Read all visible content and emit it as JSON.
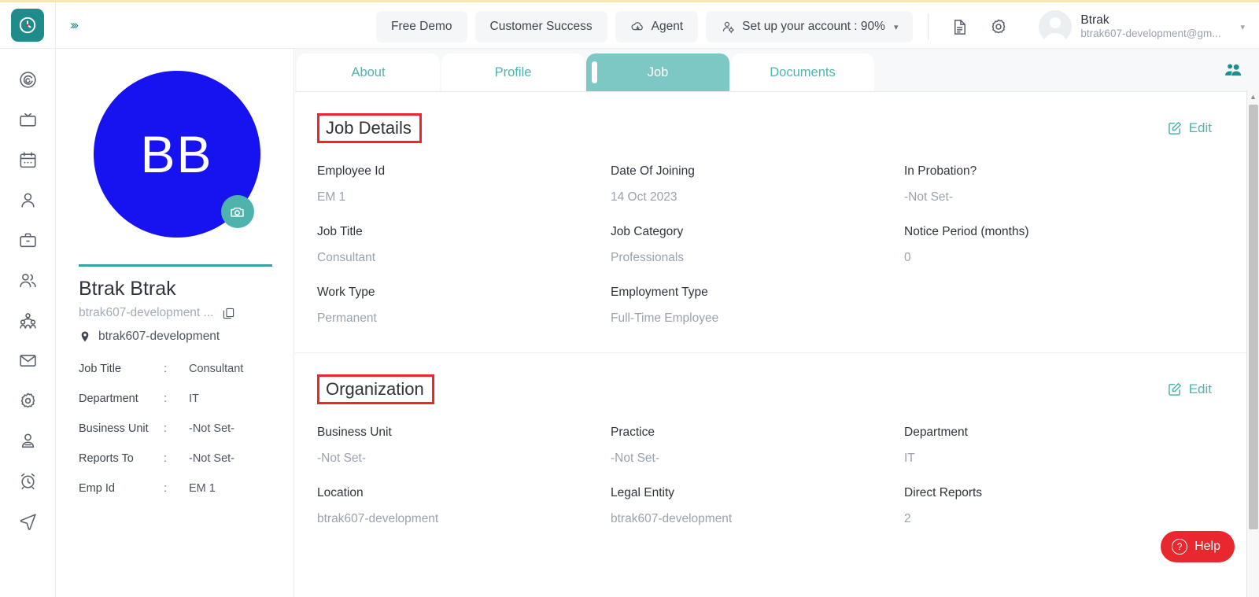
{
  "topbar": {
    "logo_icon": "clock-logo-icon",
    "expand_icon": "chevron-double-right-icon",
    "expand_label": "›››",
    "actions": [
      {
        "label": "Free Demo",
        "icon": ""
      },
      {
        "label": "Customer Success",
        "icon": ""
      },
      {
        "label": "Agent",
        "icon": "cloud-download-icon"
      },
      {
        "label": "Set up your account : 90%",
        "icon": "user-settings-icon",
        "caret": "▾"
      }
    ],
    "doc_icon": "document-icon",
    "gear_icon": "gear-icon",
    "user": {
      "avatar_icon": "avatar-placeholder-icon",
      "name": "Btrak",
      "email": "btrak607-development@gm...",
      "caret": "▾"
    }
  },
  "sidebar": {
    "items": [
      {
        "icon": "dashboard-spiral-icon",
        "name": "dashboard"
      },
      {
        "icon": "tv-monitor-icon",
        "name": "broadcast"
      },
      {
        "icon": "calendar-icon",
        "name": "calendar"
      },
      {
        "icon": "person-icon",
        "name": "employee"
      },
      {
        "icon": "briefcase-icon",
        "name": "jobs"
      },
      {
        "icon": "people-icon",
        "name": "teams"
      },
      {
        "icon": "org-chart-icon",
        "name": "organization"
      },
      {
        "icon": "mail-icon",
        "name": "inbox"
      },
      {
        "icon": "gear-icon",
        "name": "settings"
      },
      {
        "icon": "user-badge-icon",
        "name": "profile"
      },
      {
        "icon": "alarm-clock-icon",
        "name": "timesheet"
      },
      {
        "icon": "send-navigate-icon",
        "name": "send"
      }
    ]
  },
  "profile": {
    "avatar_initials": "BB",
    "avatar_color": "#1712f0",
    "camera_icon": "camera-icon",
    "name": "Btrak Btrak",
    "email": "btrak607-development ...",
    "copy_icon": "copy-icon",
    "location_icon": "map-pin-icon",
    "location": "btrak607-development",
    "separator": ":",
    "details": [
      {
        "key": "Job Title",
        "value": "Consultant"
      },
      {
        "key": "Department",
        "value": "IT"
      },
      {
        "key": "Business Unit",
        "value": "-Not Set-"
      },
      {
        "key": "Reports To",
        "value": "-Not Set-"
      },
      {
        "key": "Emp Id",
        "value": "EM 1"
      }
    ]
  },
  "main": {
    "tabs": [
      {
        "label": "About",
        "active": false
      },
      {
        "label": "Profile",
        "active": false
      },
      {
        "label": "Job",
        "active": true
      },
      {
        "label": "Documents",
        "active": false
      }
    ],
    "people_icon": "people-icon",
    "sections": [
      {
        "title": "Job Details",
        "edit_label": "Edit",
        "edit_icon": "edit-pencil-icon",
        "fields": [
          {
            "label": "Employee Id",
            "value": "EM 1"
          },
          {
            "label": "Date Of Joining",
            "value": "14 Oct 2023"
          },
          {
            "label": "In Probation?",
            "value": "-Not Set-"
          },
          {
            "label": "Job Title",
            "value": "Consultant"
          },
          {
            "label": "Job Category",
            "value": "Professionals"
          },
          {
            "label": "Notice Period (months)",
            "value": "0"
          },
          {
            "label": "Work Type",
            "value": "Permanent"
          },
          {
            "label": "Employment Type",
            "value": "Full-Time Employee"
          },
          {
            "label": "",
            "value": ""
          }
        ]
      },
      {
        "title": "Organization",
        "edit_label": "Edit",
        "edit_icon": "edit-pencil-icon",
        "fields": [
          {
            "label": "Business Unit",
            "value": "-Not Set-"
          },
          {
            "label": "Practice",
            "value": "-Not Set-"
          },
          {
            "label": "Department",
            "value": "IT"
          },
          {
            "label": "Location",
            "value": "btrak607-development"
          },
          {
            "label": "Legal Entity",
            "value": "btrak607-development"
          },
          {
            "label": "Direct Reports",
            "value": "2"
          }
        ]
      }
    ]
  },
  "scrollbar": {
    "up_arrow": "▲"
  },
  "help": {
    "label": "Help",
    "icon": "question-mark-icon",
    "glyph": "?",
    "color": "#e8272f"
  }
}
